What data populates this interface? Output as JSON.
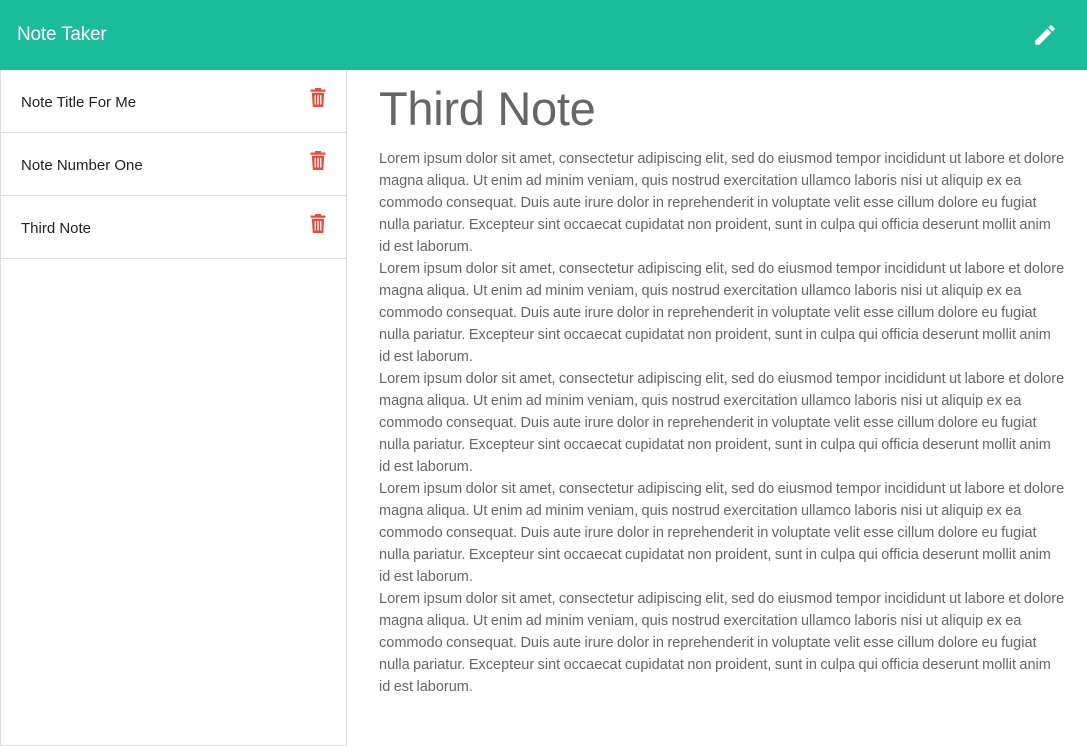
{
  "navbar": {
    "brand": "Note Taker",
    "new_note_icon": "pencil-icon"
  },
  "colors": {
    "accent": "#1abc9c",
    "delete": "#e74c3c",
    "text": "#666666"
  },
  "sidebar": {
    "delete_icon": "trash-icon",
    "notes": [
      {
        "title": "Note Title For Me"
      },
      {
        "title": "Note Number One"
      },
      {
        "title": "Third Note"
      }
    ]
  },
  "note": {
    "title": "Third Note",
    "paragraphs": [
      "Lorem ipsum dolor sit amet, consectetur adipiscing elit, sed do eiusmod tempor incididunt ut labore et dolore magna aliqua. Ut enim ad minim veniam, quis nostrud exercitation ullamco laboris nisi ut aliquip ex ea commodo consequat. Duis aute irure dolor in reprehenderit in voluptate velit esse cillum dolore eu fugiat nulla pariatur. Excepteur sint occaecat cupidatat non proident, sunt in culpa qui officia deserunt mollit anim id est laborum.",
      "Lorem ipsum dolor sit amet, consectetur adipiscing elit, sed do eiusmod tempor incididunt ut labore et dolore magna aliqua. Ut enim ad minim veniam, quis nostrud exercitation ullamco laboris nisi ut aliquip ex ea commodo consequat. Duis aute irure dolor in reprehenderit in voluptate velit esse cillum dolore eu fugiat nulla pariatur. Excepteur sint occaecat cupidatat non proident, sunt in culpa qui officia deserunt mollit anim id est laborum.",
      "Lorem ipsum dolor sit amet, consectetur adipiscing elit, sed do eiusmod tempor incididunt ut labore et dolore magna aliqua. Ut enim ad minim veniam, quis nostrud exercitation ullamco laboris nisi ut aliquip ex ea commodo consequat. Duis aute irure dolor in reprehenderit in voluptate velit esse cillum dolore eu fugiat nulla pariatur. Excepteur sint occaecat cupidatat non proident, sunt in culpa qui officia deserunt mollit anim id est laborum.",
      "Lorem ipsum dolor sit amet, consectetur adipiscing elit, sed do eiusmod tempor incididunt ut labore et dolore magna aliqua. Ut enim ad minim veniam, quis nostrud exercitation ullamco laboris nisi ut aliquip ex ea commodo consequat. Duis aute irure dolor in reprehenderit in voluptate velit esse cillum dolore eu fugiat nulla pariatur. Excepteur sint occaecat cupidatat non proident, sunt in culpa qui officia deserunt mollit anim id est laborum.",
      "Lorem ipsum dolor sit amet, consectetur adipiscing elit, sed do eiusmod tempor incididunt ut labore et dolore magna aliqua. Ut enim ad minim veniam, quis nostrud exercitation ullamco laboris nisi ut aliquip ex ea commodo consequat. Duis aute irure dolor in reprehenderit in voluptate velit esse cillum dolore eu fugiat nulla pariatur. Excepteur sint occaecat cupidatat non proident, sunt in culpa qui officia deserunt mollit anim id est laborum."
    ]
  }
}
